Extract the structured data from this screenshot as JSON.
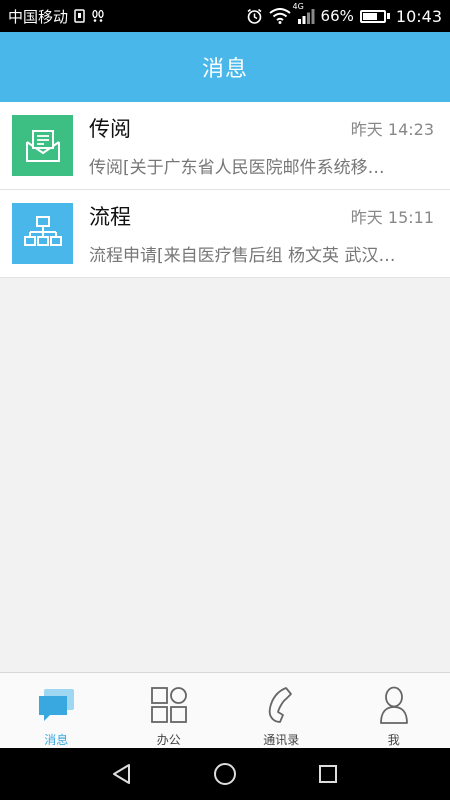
{
  "status_bar": {
    "carrier": "中国移动",
    "network_badge": "4G",
    "battery_percent": "66%",
    "battery_level": 0.66,
    "time": "10:43",
    "icons": [
      "sim-icon",
      "footprint-icon",
      "alarm-icon",
      "wifi-icon",
      "signal-icon",
      "battery-icon"
    ]
  },
  "header": {
    "title": "消息"
  },
  "messages": [
    {
      "title": "传阅",
      "time": "昨天 14:23",
      "preview": "传阅[关于广东省人民医院邮件系统移…",
      "icon": "envelope-document-icon",
      "icon_color": "#3dbf84"
    },
    {
      "title": "流程",
      "time": "昨天 15:11",
      "preview": "流程申请[来自医疗售后组 杨文英 武汉…",
      "icon": "flowchart-icon",
      "icon_color": "#4ab7ea"
    }
  ],
  "tabs": [
    {
      "label": "消息",
      "icon": "chat-icon",
      "active": true
    },
    {
      "label": "办公",
      "icon": "grid-icon",
      "active": false
    },
    {
      "label": "通讯录",
      "icon": "phone-icon",
      "active": false
    },
    {
      "label": "我",
      "icon": "person-icon",
      "active": false
    }
  ],
  "nav": {
    "icons": [
      "back-icon",
      "home-icon",
      "recents-icon"
    ]
  },
  "colors": {
    "accent": "#4ab7ea",
    "active_tab": "#3aa8e0",
    "green_icon": "#3dbf84"
  }
}
